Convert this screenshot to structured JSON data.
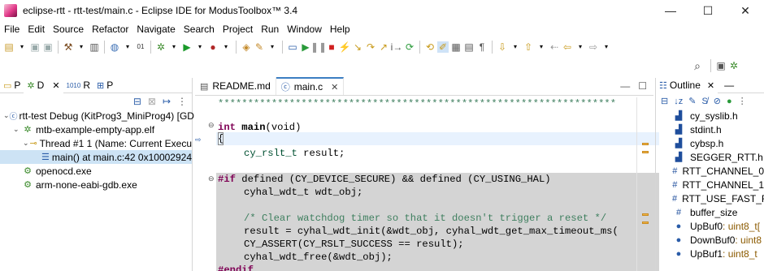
{
  "window": {
    "title": "eclipse-rtt - rtt-test/main.c - Eclipse IDE for ModusToolbox™ 3.4"
  },
  "menu": [
    "File",
    "Edit",
    "Source",
    "Refactor",
    "Navigate",
    "Search",
    "Project",
    "Run",
    "Window",
    "Help"
  ],
  "left_panel": {
    "tabs": [
      {
        "icon": "project-explorer-icon",
        "label": "P"
      },
      {
        "icon": "debug-icon",
        "label": "D"
      },
      {
        "icon": "registers-icon",
        "label": "R"
      },
      {
        "icon": "peripherals-icon",
        "label": "P"
      }
    ],
    "tree": [
      {
        "label": "rtt-test Debug (KitProg3_MiniProg4) [GD",
        "indent": 0,
        "expanded": true
      },
      {
        "label": "mtb-example-empty-app.elf",
        "indent": 1,
        "expanded": true
      },
      {
        "label": "Thread #1 1 (Name: Current Execu",
        "indent": 2,
        "expanded": true
      },
      {
        "label": "main() at main.c:42 0x10002924",
        "indent": 3,
        "selected": true
      },
      {
        "label": "openocd.exe",
        "indent": 1
      },
      {
        "label": "arm-none-eabi-gdb.exe",
        "indent": 1
      }
    ]
  },
  "editor": {
    "tabs": [
      {
        "label": "README.md",
        "active": false
      },
      {
        "label": "main.c",
        "active": true
      }
    ],
    "lines": {
      "stars": "*******************************************************************",
      "func_kw": "int",
      "func_name": "main",
      "func_params": "(void)",
      "brace": "{",
      "decl_type": "cy_rslt_t",
      "decl_rest": " result;",
      "if_kw": "#if",
      "if_rest": " defined (CY_DEVICE_SECURE) && defined (CY_USING_HAL)",
      "wdt_decl": "cyhal_wdt_t wdt_obj;",
      "comment": "/* Clear watchdog timer so that it doesn't trigger a reset */",
      "wdt_init": "result = cyhal_wdt_init(&wdt_obj, cyhal_wdt_get_max_timeout_ms(",
      "assert": "CY_ASSERT(CY_RSLT_SUCCESS == result);",
      "wdt_free": "cyhal_wdt_free(&wdt_obj);",
      "endif": "#endif"
    }
  },
  "outline": {
    "tab_label": "Outline",
    "items": [
      {
        "icon": "include-icon",
        "label": "cy_syslib.h"
      },
      {
        "icon": "include-icon",
        "label": "stdint.h"
      },
      {
        "icon": "include-icon",
        "label": "cybsp.h"
      },
      {
        "icon": "include-icon",
        "label": "SEGGER_RTT.h"
      },
      {
        "icon": "macro-icon",
        "label": "RTT_CHANNEL_0"
      },
      {
        "icon": "macro-icon",
        "label": "RTT_CHANNEL_1"
      },
      {
        "icon": "macro-icon",
        "label": "RTT_USE_FAST_RT"
      },
      {
        "icon": "macro-icon",
        "label": "buffer_size"
      },
      {
        "icon": "variable-icon",
        "label": "UpBuf0",
        "suffix": " : uint8_t["
      },
      {
        "icon": "variable-icon",
        "label": "DownBuf0",
        "suffix": " : uint8"
      },
      {
        "icon": "variable-icon",
        "label": "UpBuf1",
        "suffix": " : uint8_t"
      }
    ]
  }
}
